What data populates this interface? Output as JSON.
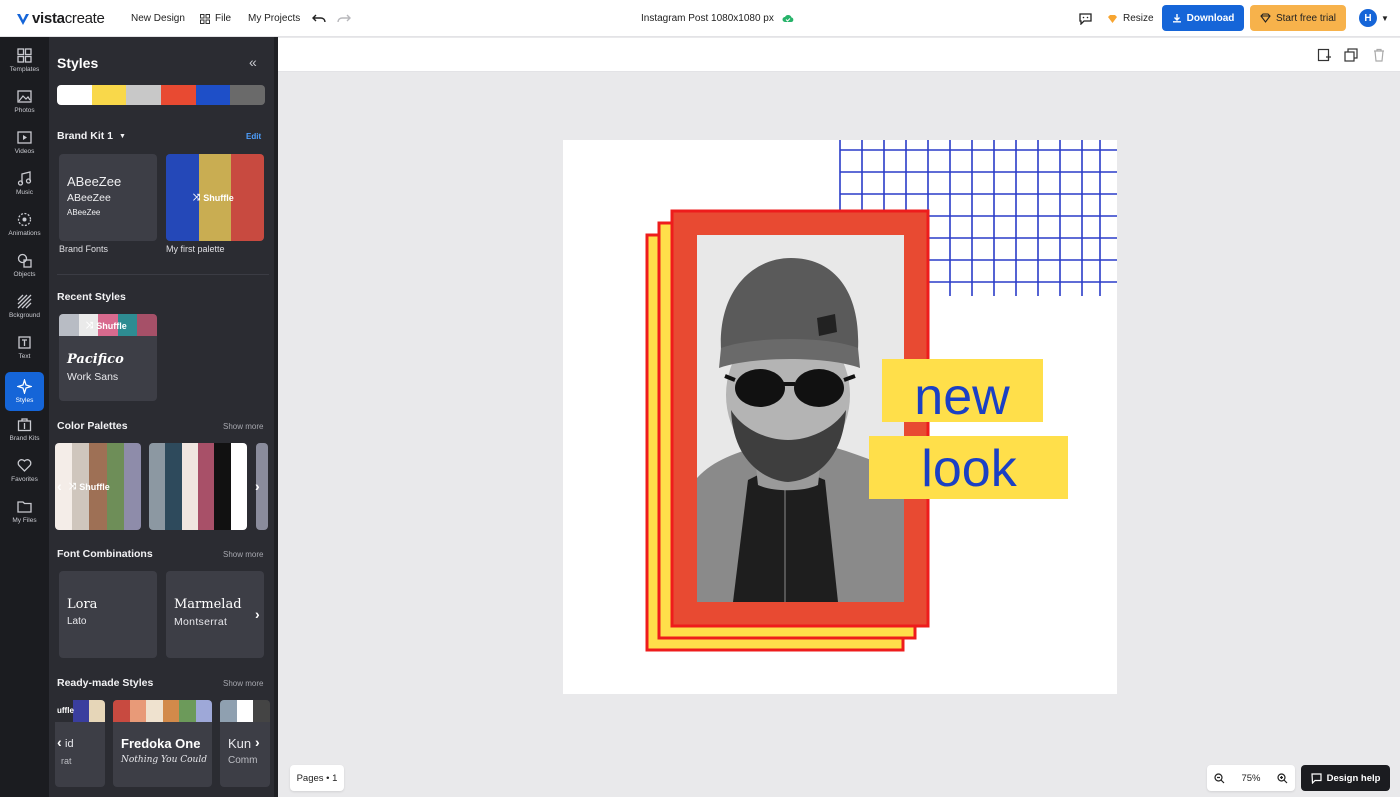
{
  "topbar": {
    "logo_bold": "vista",
    "logo_thin": "create",
    "new_design": "New Design",
    "file": "File",
    "my_projects": "My Projects",
    "doc_title": "Instagram Post 1080x1080 px",
    "resize": "Resize",
    "download": "Download",
    "trial": "Start free trial",
    "avatar_initial": "H"
  },
  "rail": [
    {
      "label": "Templates",
      "icon": "templates-icon"
    },
    {
      "label": "Photos",
      "icon": "photos-icon"
    },
    {
      "label": "Videos",
      "icon": "videos-icon"
    },
    {
      "label": "Music",
      "icon": "music-icon"
    },
    {
      "label": "Animations",
      "icon": "animations-icon"
    },
    {
      "label": "Objects",
      "icon": "objects-icon"
    },
    {
      "label": "Bckground",
      "icon": "background-icon"
    },
    {
      "label": "Text",
      "icon": "text-icon"
    },
    {
      "label": "Styles",
      "icon": "styles-icon"
    },
    {
      "label": "Brand Kits",
      "icon": "brand-kits-icon"
    },
    {
      "label": "Favorites",
      "icon": "favorites-icon"
    },
    {
      "label": "My Files",
      "icon": "my-files-icon"
    }
  ],
  "panel": {
    "title": "Styles",
    "top_palette": [
      "#ffffff",
      "#f9d84a",
      "#c8c8c8",
      "#e84a32",
      "#1e4fc8",
      "#6a6a6a"
    ],
    "brand_kit": {
      "name": "Brand Kit 1",
      "edit": "Edit",
      "fonts": [
        "ABeeZee",
        "ABeeZee",
        "ABeeZee"
      ],
      "fonts_caption": "Brand Fonts",
      "palette": [
        "#2448b8",
        "#c9ad52",
        "#c84a40"
      ],
      "palette_caption": "My first palette",
      "shuffle": "Shuffle"
    },
    "recent": {
      "title": "Recent Styles",
      "colors": [
        "#b8bcc4",
        "#eaeaea",
        "#d86a8e",
        "#2e8c92",
        "#a65068"
      ],
      "shuffle": "Shuffle",
      "font1": "Pacifico",
      "font2": "Work Sans"
    },
    "color_palettes": {
      "title": "Color Palettes",
      "show_more": "Show more",
      "p1": [
        "#f4ede8",
        "#cfc6bd",
        "#9e7055",
        "#6e8e58",
        "#8e8caa"
      ],
      "p2": [
        "#8c98a2",
        "#2e4a5c",
        "#f0e6e0",
        "#a85068",
        "#111111",
        "#ffffff"
      ],
      "shuffle": "Shuffle"
    },
    "font_combos": {
      "title": "Font Combinations",
      "show_more": "Show more",
      "c1_a": "Lora",
      "c1_b": "Lato",
      "c2_a": "Marmelad",
      "c2_b": "Montserrat"
    },
    "ready_made": {
      "title": "Ready-made Styles",
      "show_more": "Show more",
      "s1_colors": [
        "#3a3e9e",
        "#e6d6b8"
      ],
      "s1_a": "uffle",
      "s1_b": "id",
      "s1_c": "rat",
      "s2_colors": [
        "#c84a40",
        "#e89a78",
        "#efe2cf",
        "#d28a4a",
        "#6c9a5a",
        "#9ea8d8"
      ],
      "s2_a": "Fredoka One",
      "s2_b": "Nothing You Could",
      "s3_colors": [
        "#8fa0b0",
        "#ffffff",
        "#444444"
      ],
      "s3_a": "Kun",
      "s3_b": "Comm"
    }
  },
  "canvas": {
    "word1": "new",
    "word2": "look",
    "colors": {
      "red": "#e84a32",
      "yellow": "#ffdf4a",
      "blue": "#1b40c4",
      "grid": "#2a3cc8"
    }
  },
  "bottom": {
    "pages": "Pages • 1",
    "zoom": "75%",
    "help": "Design help"
  }
}
